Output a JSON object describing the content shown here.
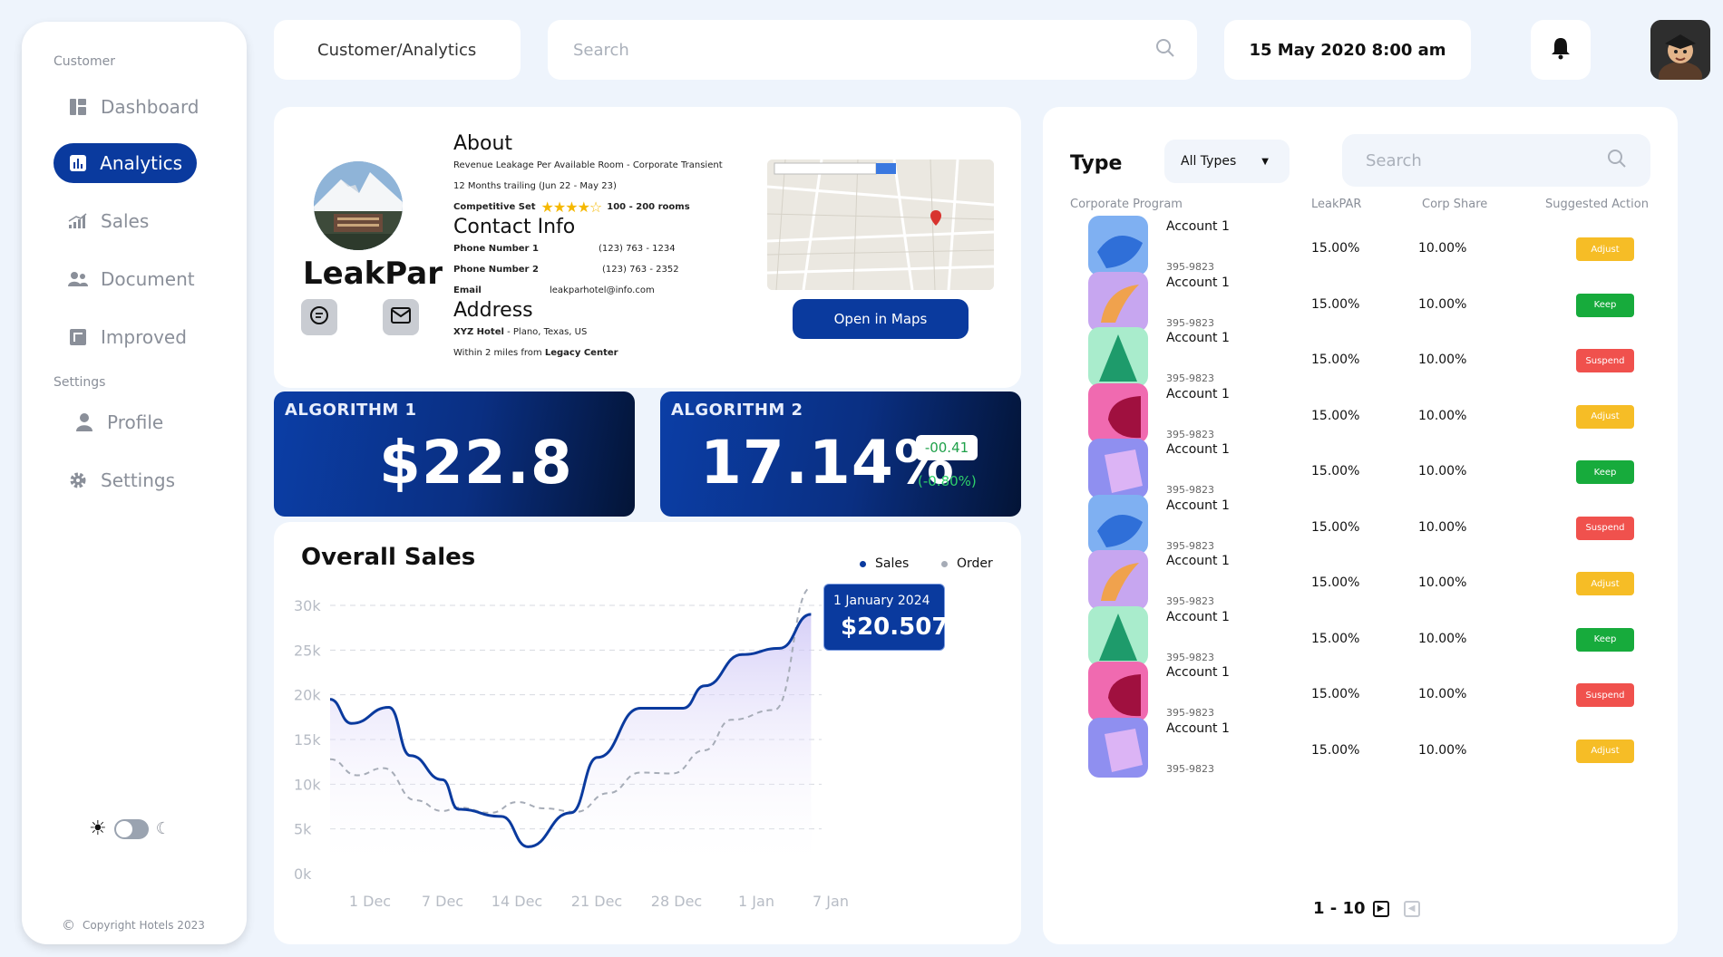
{
  "sidebar": {
    "section_customer": "Customer",
    "section_settings": "Settings",
    "items": [
      {
        "label": "Dashboard",
        "icon": "dashboard-icon"
      },
      {
        "label": "Analytics",
        "icon": "bar-chart-icon"
      },
      {
        "label": "Sales",
        "icon": "signal-icon"
      },
      {
        "label": "Document",
        "icon": "users-icon"
      },
      {
        "label": "Improved",
        "icon": "document-icon"
      },
      {
        "label": "Profile",
        "icon": "user-icon"
      },
      {
        "label": "Settings",
        "icon": "gear-icon"
      }
    ],
    "copyright": "Copyright Hotels 2023"
  },
  "header": {
    "breadcrumb": "Customer/Analytics",
    "search_placeholder": "Search",
    "datetime": "15 May 2020 8:00 am"
  },
  "profile": {
    "name": "LeakPar",
    "about_title": "About",
    "about_line1": "Revenue Leakage Per Available Room - Corporate Transient",
    "about_line2": "12 Months trailing (Jun 22 - May 23)",
    "competitive_label": "Competitive Set",
    "competitive_rating": 4.5,
    "rooms": "100 - 200 rooms",
    "contact_title": "Contact Info",
    "phone1_label": "Phone Number 1",
    "phone1": "(123) 763 - 1234",
    "phone2_label": "Phone Number 2",
    "phone2": "(123) 763 - 2352",
    "email_label": "Email",
    "email": "leakparhotel@info.com",
    "address_title": "Address",
    "hotel_name": "XYZ Hotel",
    "hotel_address": " - Plano, Texas, US",
    "proximity_prefix": "Within 2 miles from ",
    "proximity_place": "Legacy Center",
    "map_button": "Open in Maps"
  },
  "algorithms": [
    {
      "title": "ALGORITHM 1",
      "value": "$22.8"
    },
    {
      "title": "ALGORITHM 2",
      "value": "17.14%",
      "delta": "-00.41",
      "delta_pct": "(-0.80%)"
    }
  ],
  "chart_data": {
    "type": "line",
    "title": "Overall Sales",
    "categories": [
      "1 Dec",
      "7 Dec",
      "14 Dec",
      "21 Dec",
      "28 Dec",
      "1 Jan",
      "7 Jan"
    ],
    "y_ticks": [
      "30k",
      "25k",
      "20k",
      "15k",
      "10k",
      "5k",
      "0k"
    ],
    "ylim": [
      0,
      30000
    ],
    "legend_position": "top-right",
    "series": [
      {
        "name": "Sales",
        "color": "#0a3a9e",
        "style": "solid",
        "points": [
          [
            0,
            19500
          ],
          [
            0.4,
            16800
          ],
          [
            1.1,
            18600
          ],
          [
            1.5,
            13200
          ],
          [
            2.1,
            10500
          ],
          [
            2.4,
            7200
          ],
          [
            3.2,
            6400
          ],
          [
            3.7,
            3000
          ],
          [
            4.5,
            6800
          ],
          [
            5.0,
            13000
          ],
          [
            5.8,
            18500
          ],
          [
            6.6,
            18500
          ],
          [
            7.0,
            21000
          ],
          [
            7.7,
            24500
          ],
          [
            8.4,
            25200
          ],
          [
            8.99,
            29000
          ]
        ]
      },
      {
        "name": "Order",
        "color": "#a6acb7",
        "style": "dashed",
        "points": [
          [
            0,
            12800
          ],
          [
            0.5,
            11000
          ],
          [
            1.0,
            11800
          ],
          [
            1.6,
            8200
          ],
          [
            2.1,
            7000
          ],
          [
            2.4,
            7400
          ],
          [
            3.0,
            6800
          ],
          [
            3.5,
            8000
          ],
          [
            4.0,
            7300
          ],
          [
            4.6,
            6900
          ],
          [
            5.2,
            9000
          ],
          [
            5.8,
            11300
          ],
          [
            6.4,
            11200
          ],
          [
            7.0,
            13800
          ],
          [
            7.5,
            17200
          ],
          [
            8.3,
            18300
          ],
          [
            8.99,
            32000
          ]
        ]
      }
    ],
    "tooltip": {
      "date": "1 January 2024",
      "value": "$20.507"
    }
  },
  "table": {
    "type_label": "Type",
    "filter_value": "All Types",
    "search_placeholder": "Search",
    "headers": [
      "Corporate Program",
      "LeakPAR",
      "Corp Share",
      "Suggested Action"
    ],
    "rows": [
      {
        "name": "Account 1",
        "number": "395-9823",
        "leakpar": "15.00%",
        "share": "10.00%",
        "action": "Adjust",
        "thumb": "blue"
      },
      {
        "name": "Account 1",
        "number": "395-9823",
        "leakpar": "15.00%",
        "share": "10.00%",
        "action": "Keep",
        "thumb": "orange"
      },
      {
        "name": "Account 1",
        "number": "395-9823",
        "leakpar": "15.00%",
        "share": "10.00%",
        "action": "Suspend",
        "thumb": "green"
      },
      {
        "name": "Account 1",
        "number": "395-9823",
        "leakpar": "15.00%",
        "share": "10.00%",
        "action": "Adjust",
        "thumb": "pink"
      },
      {
        "name": "Account 1",
        "number": "395-9823",
        "leakpar": "15.00%",
        "share": "10.00%",
        "action": "Keep",
        "thumb": "purple"
      },
      {
        "name": "Account 1",
        "number": "395-9823",
        "leakpar": "15.00%",
        "share": "10.00%",
        "action": "Suspend",
        "thumb": "blue"
      },
      {
        "name": "Account 1",
        "number": "395-9823",
        "leakpar": "15.00%",
        "share": "10.00%",
        "action": "Adjust",
        "thumb": "orange"
      },
      {
        "name": "Account 1",
        "number": "395-9823",
        "leakpar": "15.00%",
        "share": "10.00%",
        "action": "Keep",
        "thumb": "green"
      },
      {
        "name": "Account 1",
        "number": "395-9823",
        "leakpar": "15.00%",
        "share": "10.00%",
        "action": "Suspend",
        "thumb": "pink"
      },
      {
        "name": "Account 1",
        "number": "395-9823",
        "leakpar": "15.00%",
        "share": "10.00%",
        "action": "Adjust",
        "thumb": "purple"
      }
    ],
    "pagination": "1 - 10"
  },
  "colors": {
    "primary": "#0a3a9e",
    "adjust": "#f6bd26",
    "keep": "#17ab3c",
    "suspend": "#f0514d"
  }
}
